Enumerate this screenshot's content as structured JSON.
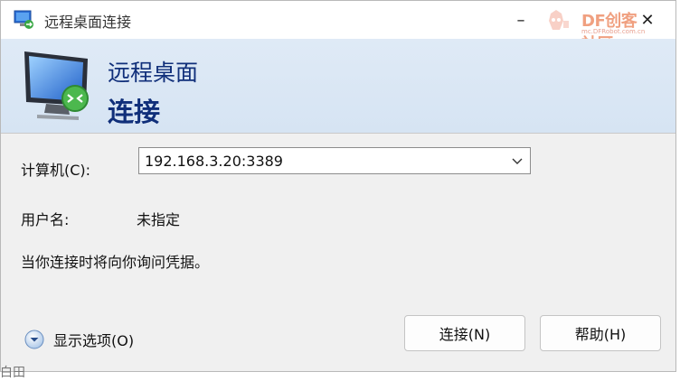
{
  "window": {
    "title": "远程桌面连接"
  },
  "titlebar": {
    "minimize_label": "–",
    "close_label": "✕"
  },
  "watermark": {
    "brand": "DF创客社区",
    "site": "mc.DFRobot.com.cn"
  },
  "banner": {
    "line1": "远程桌面",
    "line2": "连接"
  },
  "form": {
    "computer_label": "计算机(C):",
    "computer_value": "192.168.3.20:3389",
    "username_label": "用户名:",
    "username_value": "未指定",
    "credentials_note": "当你连接时将向你询问凭据。"
  },
  "footer": {
    "show_options_label": "显示选项(O)",
    "connect_button": "连接(N)",
    "help_button": "帮助(H)",
    "fragment_text": "白田"
  },
  "icons": {
    "title": "remote-desktop-icon",
    "banner": "monitor-remote-icon",
    "combo": "chevron-down-icon",
    "options": "expand-circle-icon"
  },
  "colors": {
    "banner_text": "#102f7a",
    "banner_bg": "#dfeaf6"
  }
}
